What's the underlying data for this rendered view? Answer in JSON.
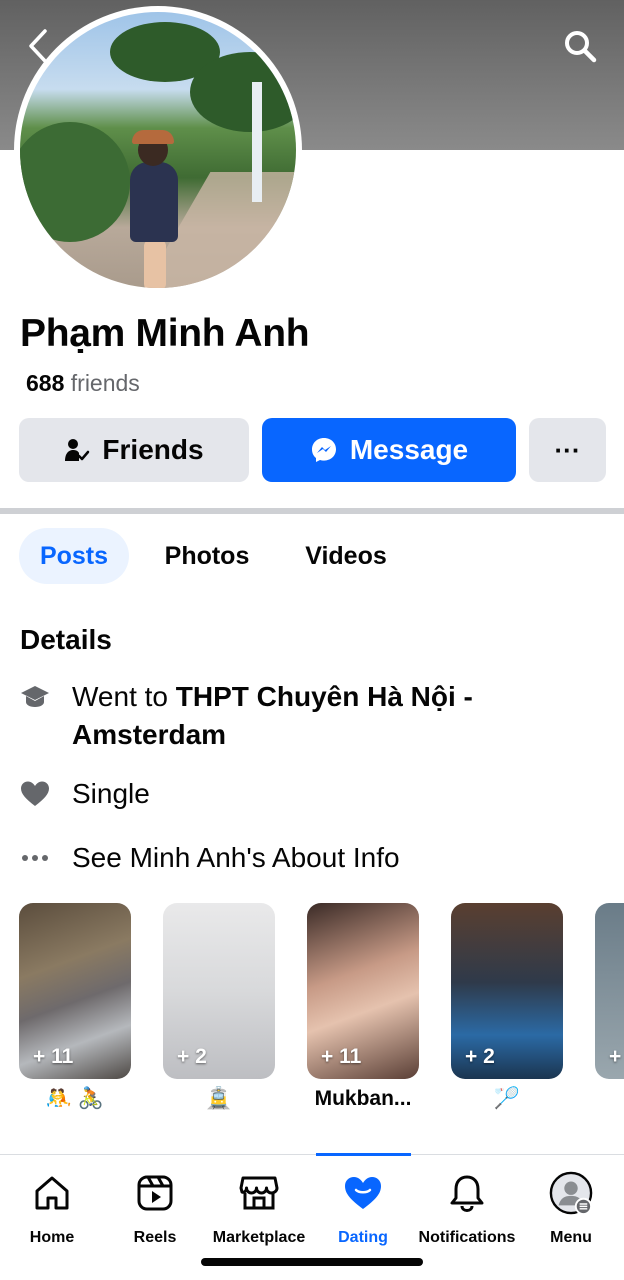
{
  "profile": {
    "name": "Phạm Minh Anh",
    "friends_count": "688",
    "friends_word": "friends"
  },
  "actions": {
    "friends_label": "Friends",
    "message_label": "Message",
    "more_label": "···"
  },
  "tabs": [
    {
      "label": "Posts",
      "active": true
    },
    {
      "label": "Photos",
      "active": false
    },
    {
      "label": "Videos",
      "active": false
    }
  ],
  "details": {
    "title": "Details",
    "education_prefix": "Went to ",
    "education_school": "THPT Chuyên Hà Nội - Amsterdam",
    "relationship": "Single",
    "about_link": "See Minh Anh's About Info"
  },
  "highlights": [
    {
      "count": "+ 11",
      "label": "🤼 🚴"
    },
    {
      "count": "+ 2",
      "label": "🚊"
    },
    {
      "count": "+ 11",
      "label": "Mukban..."
    },
    {
      "count": "+ 2",
      "label": "🏸"
    },
    {
      "count": "+",
      "label": ""
    }
  ],
  "bottom_nav": [
    {
      "label": "Home",
      "icon": "home-icon"
    },
    {
      "label": "Reels",
      "icon": "reels-icon"
    },
    {
      "label": "Marketplace",
      "icon": "marketplace-icon"
    },
    {
      "label": "Dating",
      "icon": "heart-icon",
      "active": true
    },
    {
      "label": "Notifications",
      "icon": "bell-icon"
    },
    {
      "label": "Menu",
      "icon": "avatar-menu-icon"
    }
  ],
  "colors": {
    "accent": "#0866ff",
    "button_gray": "#e4e6eb",
    "text_secondary": "#65676b"
  }
}
